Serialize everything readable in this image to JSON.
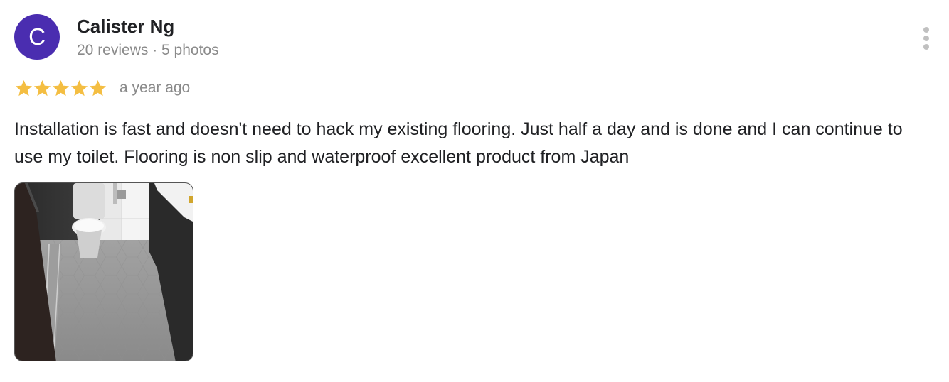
{
  "reviewer": {
    "avatar_initial": "C",
    "avatar_color": "#4a2db0",
    "name": "Calister Ng",
    "meta": "20 reviews · 5 photos"
  },
  "review": {
    "rating": 5,
    "max_rating": 5,
    "star_color": "#f4be42",
    "date": "a year ago",
    "text": "Installation is fast and doesn't need to hack my existing flooring. Just half a day and is done and I can continue to use my toilet. Flooring is non slip and waterproof excellent product from Japan"
  },
  "photos": [
    {
      "subject": "bathroom with toilet and grey hexagon floor"
    }
  ],
  "icons": {
    "more": "more-vert-icon",
    "star": "star-icon"
  }
}
